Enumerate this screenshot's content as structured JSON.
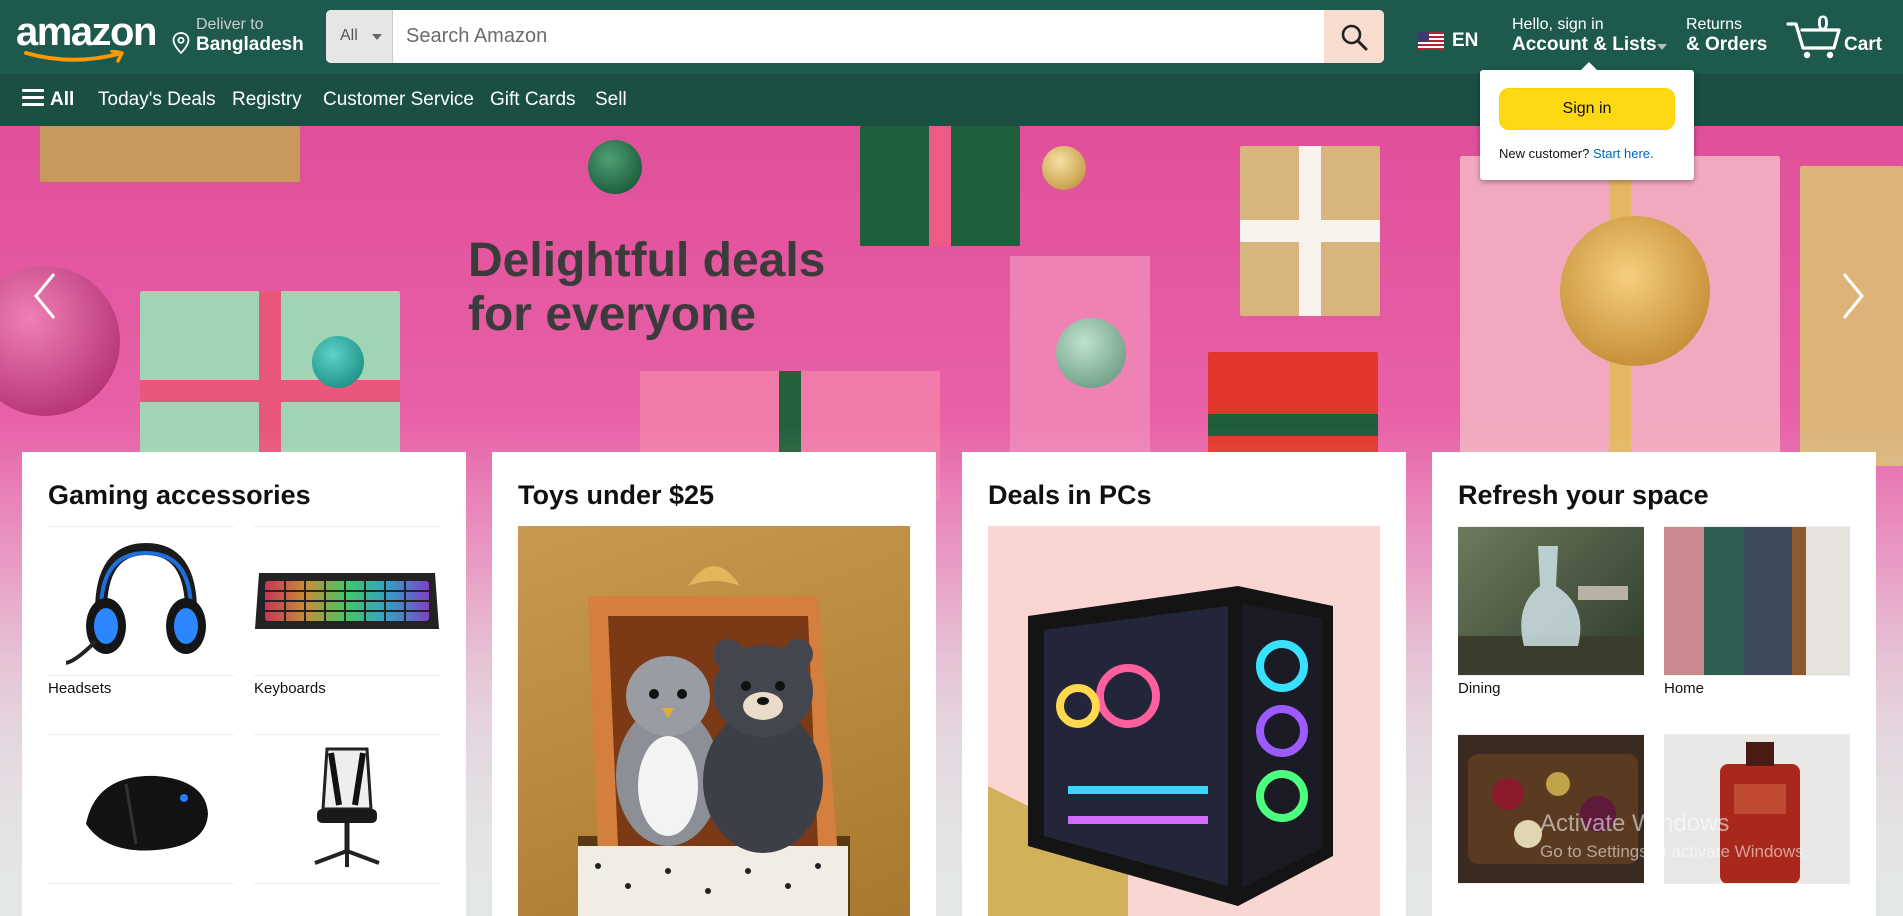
{
  "header": {
    "logo": "amazon",
    "deliver_line1": "Deliver to",
    "deliver_line2": "Bangladesh",
    "search_category": "All",
    "search_placeholder": "Search Amazon",
    "language": "EN",
    "account_line1": "Hello, sign in",
    "account_line2": "Account & Lists",
    "orders_line1": "Returns",
    "orders_line2": "& Orders",
    "cart_count": "0",
    "cart_label": "Cart",
    "brand_color": "#1d5a4d"
  },
  "nav": {
    "all_label": "All",
    "items": [
      "Today's Deals",
      "Registry",
      "Customer Service",
      "Gift Cards",
      "Sell"
    ]
  },
  "hero": {
    "headline": "Delightful deals for everyone"
  },
  "signin_flyout": {
    "button_label": "Sign in",
    "new_customer": "New customer?",
    "start_here": "Start here."
  },
  "cards": [
    {
      "title": "Gaming accessories",
      "tiles": [
        {
          "caption": "Headsets",
          "icon": "headset-icon"
        },
        {
          "caption": "Keyboards",
          "icon": "keyboard-icon"
        },
        {
          "caption": "",
          "icon": "mouse-icon"
        },
        {
          "caption": "",
          "icon": "gaming-chair-icon"
        }
      ]
    },
    {
      "title": "Toys under $25",
      "image": "plush-toys-image"
    },
    {
      "title": "Deals in PCs",
      "image": "gaming-pc-image"
    },
    {
      "title": "Refresh your space",
      "tiles": [
        {
          "caption": "Dining",
          "icon": "dining-image"
        },
        {
          "caption": "Home",
          "icon": "home-image"
        },
        {
          "caption": "",
          "icon": "kitchen-image"
        },
        {
          "caption": "",
          "icon": "bath-image"
        }
      ]
    }
  ],
  "watermark": {
    "line1": "Activate Windows",
    "line2": "Go to Settings to activate Windows."
  }
}
